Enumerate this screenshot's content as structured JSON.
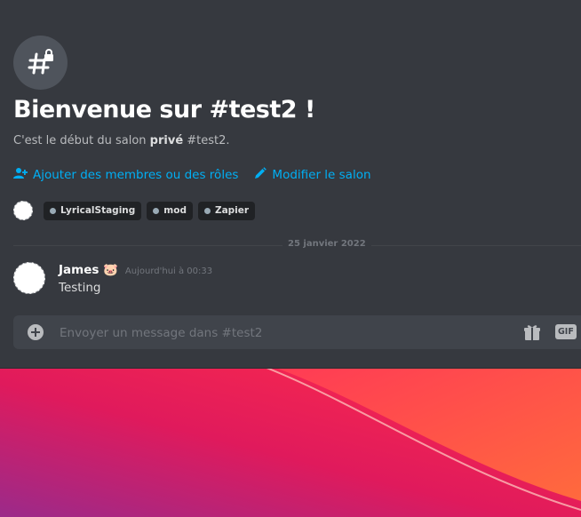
{
  "welcome": {
    "title": "Bienvenue sur #test2 !",
    "subtitle_prefix": "C'est le début du salon ",
    "subtitle_bold": "privé",
    "subtitle_suffix": " #test2."
  },
  "actions": {
    "add_members": "Ajouter des membres ou des rôles",
    "edit_channel": "Modifier le salon"
  },
  "roles": [
    {
      "name": "LyricalStaging"
    },
    {
      "name": "mod"
    },
    {
      "name": "Zapier"
    }
  ],
  "divider": {
    "date": "25 janvier 2022"
  },
  "message": {
    "author": "James 🐷",
    "timestamp": "Aujourd'hui à 00:33",
    "content": "Testing"
  },
  "composer": {
    "placeholder": "Envoyer un message dans #test2",
    "gif_label": "GIF"
  },
  "colors": {
    "background": "#36393f",
    "link": "#00aff4",
    "input": "#40444b",
    "role_chip": "#202225"
  },
  "icons": {
    "channel": "hashtag-lock-icon",
    "add_members": "person-add-icon",
    "edit": "pencil-icon",
    "plus": "plus-circle-icon",
    "gift": "gift-icon"
  }
}
